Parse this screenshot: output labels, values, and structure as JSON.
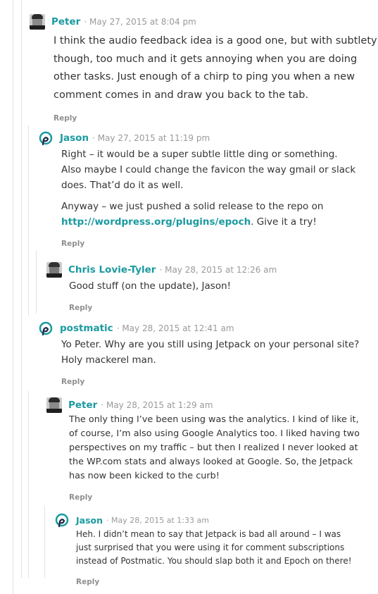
{
  "comments": [
    {
      "author": "Peter",
      "date": "May 27, 2015 at 8:04 pm",
      "paragraphs": [
        "I think the audio feedback idea is a good one, but with subtlety, though, too much and it gets annoying when you are doing other tasks. Just enough of a chirp to ping you when a new comment comes in and draw you back to the tab."
      ],
      "reply_label": "Reply"
    },
    {
      "author": "Jason",
      "date": "May 27, 2015 at 11:19 pm",
      "paragraphs": [
        "Right – it would be a super subtle little ding or something. Also maybe I could change the favicon the way gmail or slack does. That’d do it as well."
      ],
      "p2_before": "Anyway – we just pushed a solid release to the repo on",
      "p2_link": "http://wordpress.org/plugins/epoch",
      "p2_after": ". Give it a try!",
      "reply_label": "Reply"
    },
    {
      "author": "Chris Lovie-Tyler",
      "date": "May 28, 2015 at 12:26 am",
      "paragraphs": [
        "Good stuff (on the update), Jason!"
      ],
      "reply_label": "Reply"
    },
    {
      "author": "postmatic",
      "date": "May 28, 2015 at 12:41 am",
      "paragraphs": [
        "Yo Peter. Why are you still using Jetpack on your personal site? Holy mackerel man."
      ],
      "reply_label": "Reply"
    },
    {
      "author": "Peter",
      "date": "May 28, 2015 at 1:29 am",
      "paragraphs": [
        "The only thing I’ve been using was the analytics. I kind of like it, of course, I’m also using Google Analytics too. I liked having two perspectives on my traffic – but then I realized I never looked at the WP.com stats and always looked at Google. So, the Jetpack has now been kicked to the curb!"
      ],
      "reply_label": "Reply"
    },
    {
      "author": "Jason",
      "date": "May 28, 2015 at 1:33 am",
      "paragraphs": [
        "Heh. I didn’t mean to say that Jetpack is bad all around – I was just surprised that you were using it for comment subscriptions instead of Postmatic. You should slap both it and Epoch on there!"
      ],
      "reply_label": "Reply"
    }
  ],
  "separator": " · ",
  "colors": {
    "author": "#1a9aa0",
    "meta": "#9a9a9a",
    "text": "#333333",
    "reply": "#8f8f8f",
    "thread_line": "#e2e2e2"
  }
}
